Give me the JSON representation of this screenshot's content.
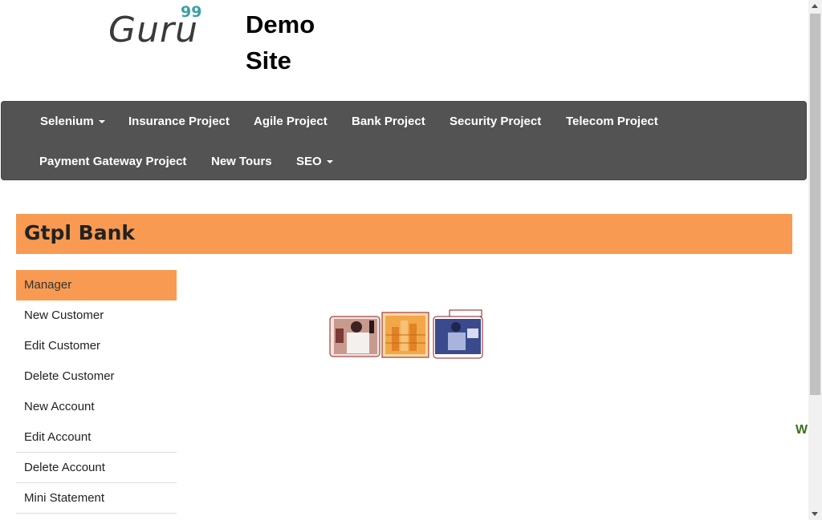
{
  "logo": {
    "text": "Guru",
    "superscript": "99"
  },
  "site_title": "Demo Site",
  "nav": {
    "row1": [
      {
        "label": "Selenium",
        "dropdown": true
      },
      {
        "label": "Insurance Project",
        "dropdown": false
      },
      {
        "label": "Agile Project",
        "dropdown": false
      },
      {
        "label": "Bank Project",
        "dropdown": false
      },
      {
        "label": "Security Project",
        "dropdown": false
      },
      {
        "label": "Telecom Project",
        "dropdown": false
      }
    ],
    "row2": [
      {
        "label": "Payment Gateway Project",
        "dropdown": false
      },
      {
        "label": "New Tours",
        "dropdown": false
      },
      {
        "label": "SEO",
        "dropdown": true
      }
    ]
  },
  "bank": {
    "title": "Gtpl Bank"
  },
  "sidebar": {
    "items": [
      {
        "label": "Manager",
        "active": true
      },
      {
        "label": "New Customer"
      },
      {
        "label": "Edit Customer"
      },
      {
        "label": "Delete Customer"
      },
      {
        "label": "New Account"
      },
      {
        "label": "Edit Account"
      },
      {
        "label": "Delete Account"
      },
      {
        "label": "Mini Statement"
      }
    ]
  },
  "right_edge_text": "W",
  "colors": {
    "nav_bg": "#535353",
    "accent": "#f89a51",
    "logo_accent": "#3aa0a8"
  }
}
